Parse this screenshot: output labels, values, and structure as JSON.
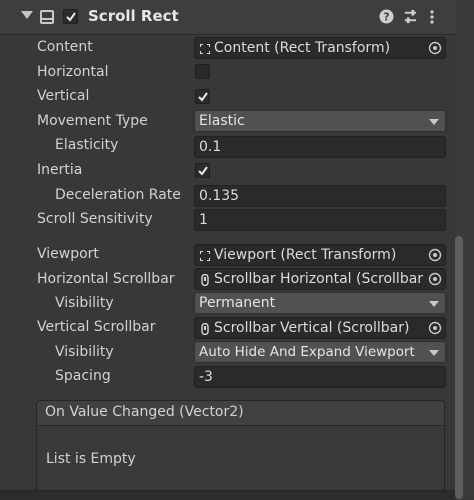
{
  "component": {
    "title": "Scroll Rect",
    "enabled": true,
    "icons": [
      "collapse-arrow-icon",
      "scroll-rect-component-icon",
      "help-icon",
      "presets-icon",
      "more-menu-icon"
    ]
  },
  "properties": {
    "content": {
      "label": "Content",
      "value": "Content (Rect Transform)"
    },
    "horizontal": {
      "label": "Horizontal",
      "checked": false
    },
    "vertical": {
      "label": "Vertical",
      "checked": true
    },
    "movement_type": {
      "label": "Movement Type",
      "value": "Elastic"
    },
    "elasticity": {
      "label": "Elasticity",
      "value": "0.1"
    },
    "inertia": {
      "label": "Inertia",
      "checked": true
    },
    "deceleration_rate": {
      "label": "Deceleration Rate",
      "value": "0.135"
    },
    "scroll_sensitivity": {
      "label": "Scroll Sensitivity",
      "value": "1"
    },
    "viewport": {
      "label": "Viewport",
      "value": "Viewport (Rect Transform)"
    },
    "horizontal_scrollbar": {
      "label": "Horizontal Scrollbar",
      "value": "Scrollbar Horizontal (Scrollbar"
    },
    "horizontal_visibility": {
      "label": "Visibility",
      "value": "Permanent"
    },
    "vertical_scrollbar": {
      "label": "Vertical Scrollbar",
      "value": "Scrollbar Vertical (Scrollbar)"
    },
    "vertical_visibility": {
      "label": "Visibility",
      "value": "Auto Hide And Expand Viewport"
    },
    "spacing": {
      "label": "Spacing",
      "value": "-3"
    }
  },
  "event": {
    "title": "On Value Changed (Vector2)",
    "empty_text": "List is Empty"
  },
  "colors": {
    "background": "#383838",
    "field": "#2a2a2a",
    "dropdown": "#515151",
    "text": "#d2d2d2"
  }
}
